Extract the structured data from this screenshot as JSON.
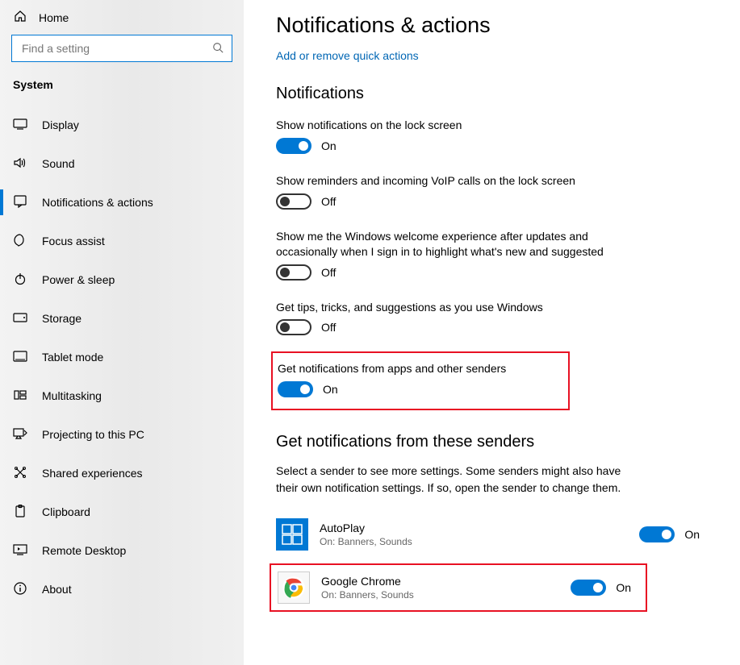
{
  "sidebar": {
    "home_label": "Home",
    "search_placeholder": "Find a setting",
    "group_title": "System",
    "items": [
      {
        "label": "Display"
      },
      {
        "label": "Sound"
      },
      {
        "label": "Notifications & actions"
      },
      {
        "label": "Focus assist"
      },
      {
        "label": "Power & sleep"
      },
      {
        "label": "Storage"
      },
      {
        "label": "Tablet mode"
      },
      {
        "label": "Multitasking"
      },
      {
        "label": "Projecting to this PC"
      },
      {
        "label": "Shared experiences"
      },
      {
        "label": "Clipboard"
      },
      {
        "label": "Remote Desktop"
      },
      {
        "label": "About"
      }
    ]
  },
  "main": {
    "title": "Notifications & actions",
    "quick_actions_link": "Add or remove quick actions",
    "section_notifications": "Notifications",
    "settings": [
      {
        "label": "Show notifications on the lock screen",
        "state": "On",
        "on": true
      },
      {
        "label": "Show reminders and incoming VoIP calls on the lock screen",
        "state": "Off",
        "on": false
      },
      {
        "label": "Show me the Windows welcome experience after updates and occasionally when I sign in to highlight what's new and suggested",
        "state": "Off",
        "on": false
      },
      {
        "label": "Get tips, tricks, and suggestions as you use Windows",
        "state": "Off",
        "on": false
      },
      {
        "label": "Get notifications from apps and other senders",
        "state": "On",
        "on": true
      }
    ],
    "section_senders": "Get notifications from these senders",
    "senders_text": "Select a sender to see more settings. Some senders might also have their own notification settings. If so, open the sender to change them.",
    "senders": [
      {
        "name": "AutoPlay",
        "sub": "On: Banners, Sounds",
        "state": "On",
        "on": true
      },
      {
        "name": "Google Chrome",
        "sub": "On: Banners, Sounds",
        "state": "On",
        "on": true
      }
    ]
  }
}
